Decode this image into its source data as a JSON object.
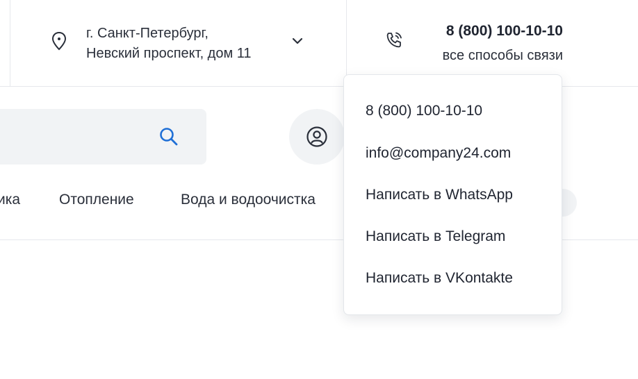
{
  "header": {
    "address_line1": "г. Санкт-Петербург,",
    "address_line2": "Невский проспект, дом 11",
    "phone": "8 (800) 100-10-10",
    "all_contacts": "все способы связи"
  },
  "search": {
    "placeholder": ""
  },
  "nav": {
    "items": [
      "ика",
      "Отопление",
      "Вода и водоочистка"
    ]
  },
  "contacts_dropdown": {
    "items": [
      "8 (800) 100-10-10",
      "info@company24.com",
      "Написать в WhatsApp",
      "Написать в Telegram",
      "Написать в VKontakte"
    ]
  },
  "icons": {
    "location": "map-pin-icon",
    "chevron": "chevron-down-icon",
    "phone": "phone-ringing-icon",
    "search": "search-icon",
    "account": "user-circle-icon"
  },
  "colors": {
    "accent": "#1f6fd6",
    "text": "#1f2430",
    "panel_bg": "#f1f3f5",
    "divider": "#e6e8ec"
  }
}
